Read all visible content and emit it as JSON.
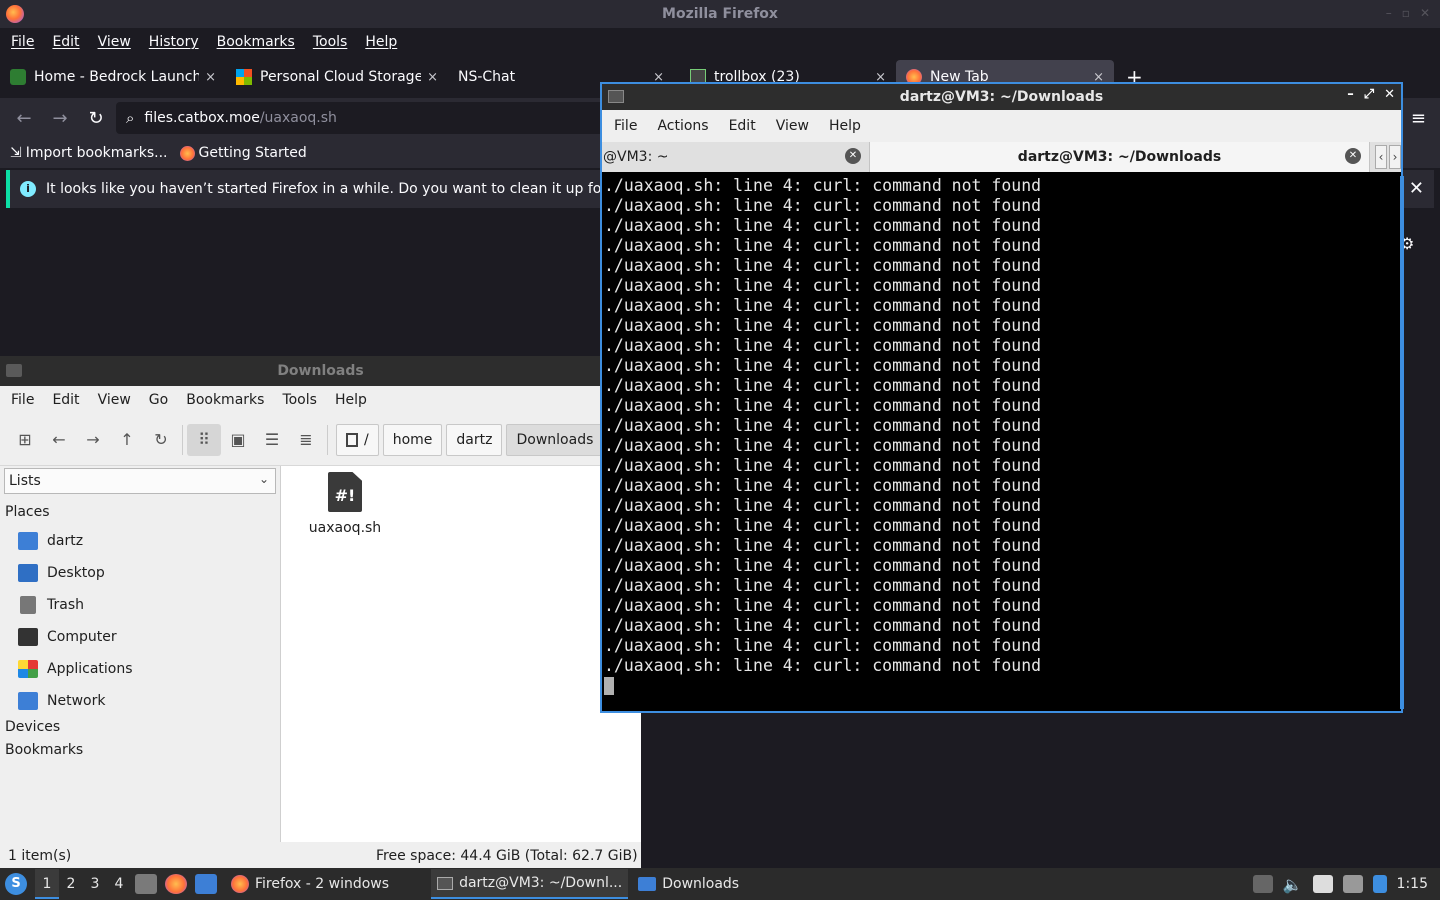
{
  "firefox": {
    "window_title": "Mozilla Firefox",
    "menu": [
      "File",
      "Edit",
      "View",
      "History",
      "Bookmarks",
      "Tools",
      "Help"
    ],
    "tabs": [
      {
        "label": "Home - Bedrock Launche",
        "close": "×"
      },
      {
        "label": "Personal Cloud Storage",
        "close": "×"
      },
      {
        "label": "NS-Chat",
        "close": "×"
      },
      {
        "label": "trollbox (23)",
        "close": "×"
      },
      {
        "label": "New Tab",
        "close": "×"
      }
    ],
    "new_tab": "+",
    "url_host": "files.catbox.moe",
    "url_path": "/uaxaoq.sh",
    "bookmarks": [
      "Import bookmarks...",
      "Getting Started"
    ],
    "notice": "It looks like you haven’t started Firefox in a while. Do you want to clean it up for a f"
  },
  "file_manager": {
    "title": "Downloads",
    "menu": [
      "File",
      "Edit",
      "View",
      "Go",
      "Bookmarks",
      "Tools",
      "Help"
    ],
    "path": [
      "/",
      "home",
      "dartz",
      "Downloads"
    ],
    "side_selector": "Lists",
    "sections": {
      "places": "Places",
      "devices": "Devices",
      "bookmarks": "Bookmarks"
    },
    "places": [
      "dartz",
      "Desktop",
      "Trash",
      "Computer",
      "Applications",
      "Network"
    ],
    "file": {
      "name": "uaxaoq.sh",
      "glyph": "#!"
    },
    "status_count": "1 item(s)",
    "status_free": "Free space: 44.4 GiB (Total: 62.7 GiB)"
  },
  "terminal": {
    "title": "dartz@VM3: ~/Downloads",
    "menu": [
      "File",
      "Actions",
      "Edit",
      "View",
      "Help"
    ],
    "tabs": [
      "@VM3: ~",
      "dartz@VM3: ~/Downloads"
    ],
    "lines": [
      "./uaxaoq.sh: line 4: curl: command not found",
      "./uaxaoq.sh: line 4: curl: command not found",
      "./uaxaoq.sh: line 4: curl: command not found",
      "./uaxaoq.sh: line 4: curl: command not found",
      "./uaxaoq.sh: line 4: curl: command not found",
      "./uaxaoq.sh: line 4: curl: command not found",
      "./uaxaoq.sh: line 4: curl: command not found",
      "./uaxaoq.sh: line 4: curl: command not found",
      "./uaxaoq.sh: line 4: curl: command not found",
      "./uaxaoq.sh: line 4: curl: command not found",
      "./uaxaoq.sh: line 4: curl: command not found",
      "./uaxaoq.sh: line 4: curl: command not found",
      "./uaxaoq.sh: line 4: curl: command not found",
      "./uaxaoq.sh: line 4: curl: command not found",
      "./uaxaoq.sh: line 4: curl: command not found",
      "./uaxaoq.sh: line 4: curl: command not found",
      "./uaxaoq.sh: line 4: curl: command not found",
      "./uaxaoq.sh: line 4: curl: command not found",
      "./uaxaoq.sh: line 4: curl: command not found",
      "./uaxaoq.sh: line 4: curl: command not found",
      "./uaxaoq.sh: line 4: curl: command not found",
      "./uaxaoq.sh: line 4: curl: command not found",
      "./uaxaoq.sh: line 4: curl: command not found",
      "./uaxaoq.sh: line 4: curl: command not found",
      "./uaxaoq.sh: line 4: curl: command not found"
    ]
  },
  "taskbar": {
    "workspaces": [
      "1",
      "2",
      "3",
      "4"
    ],
    "tasks": [
      "Firefox - 2 windows",
      "dartz@VM3: ~/Downl...",
      "Downloads"
    ],
    "clock": "1:15"
  },
  "colors": {
    "accent": "#3d8ee0",
    "firefox_bg": "#1c1b22",
    "notice_accent": "#0ddfa6"
  }
}
